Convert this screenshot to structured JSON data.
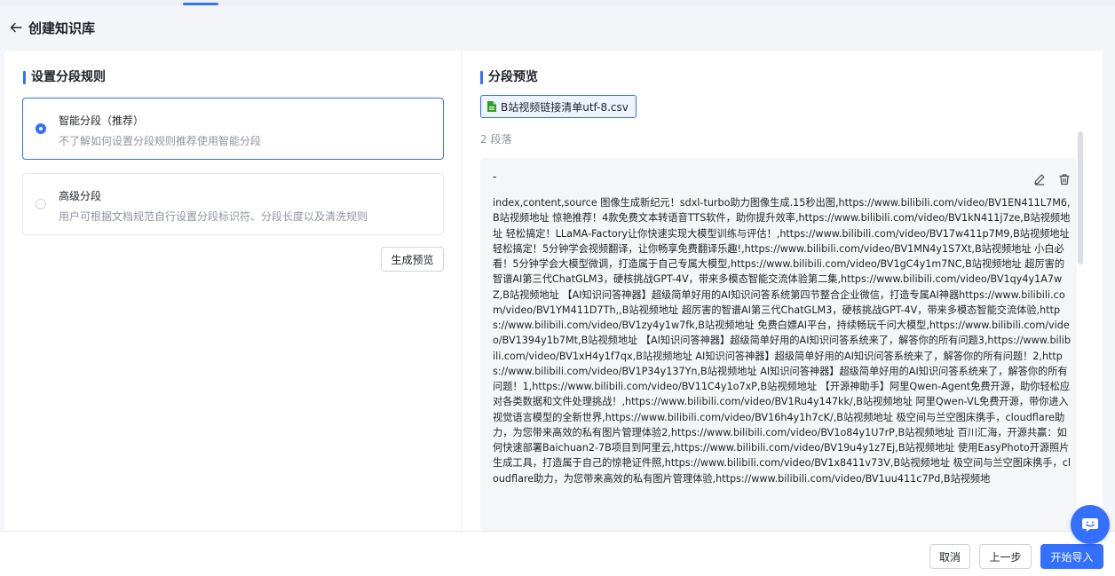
{
  "header": {
    "title": "创建知识库"
  },
  "left": {
    "title": "设置分段规则",
    "rules": [
      {
        "name": "智能分段（推荐）",
        "desc": "不了解如何设置分段规则推荐使用智能分段",
        "selected": true
      },
      {
        "name": "高级分段",
        "desc": "用户可根据文档规范自行设置分段标识符、分段长度以及清洗规则",
        "selected": false
      }
    ],
    "preview_button": "生成预览"
  },
  "right": {
    "title": "分段预览",
    "file_name": "B站视频链接清单utf-8.csv",
    "segment_count": "2 段落",
    "segment": {
      "title": "-",
      "content": "index,content,source 图像生成新纪元！sdxl-turbo助力图像生成.15秒出图,https://www.bilibili.com/video/BV1EN411L7M6,B站视频地址 惊艳推荐！4款免费文本转语音TTS软件，助你提升效率,https://www.bilibili.com/video/BV1kN411j7ze,B站视频地址 轻松搞定！LLaMA-Factory让你快速实现大模型训练与评估！,https://www.bilibili.com/video/BV17w411p7M9,B站视频地址 轻松搞定！5分钟学会视频翻译，让你畅享免费翻译乐趣!,https://www.bilibili.com/video/BV1MN4y1S7Xt,B站视频地址 小白必看！5分钟学会大模型微调，打造属于自己专属大模型,https://www.bilibili.com/video/BV1gC4y1m7NC,B站视频地址 超厉害的智谱AI第三代ChatGLM3，硬核挑战GPT-4V，带来多模态智能交流体验第二集,https://www.bilibili.com/video/BV1qy4y1A7wZ,B站视频地址 【AI知识问答神器】超级简单好用的AI知识问答系统第四节整合企业微信，打造专属AI神器https://www.bilibili.com/video/BV1YM411D7Th,,B站视频地址 超厉害的智谱AI第三代ChatGLM3，硬核挑战GPT-4V，带来多模态智能交流体验,https://www.bilibili.com/video/BV1zy4y1w7fk,B站视频地址 免费白嫖AI平台，持续畅玩千问大模型,https://www.bilibili.com/video/BV1394y1b7Mt,B站视频地址 【AI知识问答神器】超级简单好用的AI知识问答系统来了，解答你的所有问题3,https://www.bilibili.com/video/BV1xH4y1f7qx,B站视频地址 AI知识问答神器】超级简单好用的AI知识问答系统来了，解答你的所有问题！2,https://www.bilibili.com/video/BV1P34y137Yn,B站视频地址 AI知识问答神器】超级简单好用的AI知识问答系统来了，解答你的所有问题！1,https://www.bilibili.com/video/BV11C4y1o7xP,B站视频地址 【开源神助手】阿里Qwen-Agent免费开源，助你轻松应对各类数据和文件处理挑战！,https://www.bilibili.com/video/BV1Ru4y147kk/,B站视频地址 阿里Qwen-VL免费开源，带你进入视觉语言模型的全新世界,https://www.bilibili.com/video/BV16h4y1h7cK/,B站视频地址 极空间与兰空图床携手，cloudflare助力，为您带来高效的私有图片管理体验2,https://www.bilibili.com/video/BV1o84y1U7rP,B站视频地址 百川汇海，开源共赢：如何快速部署Baichuan2-7B项目到阿里云,https://www.bilibili.com/video/BV19u4y1z7Ej,B站视频地址 使用EasyPhoto开源照片生成工具，打造属于自己的惊艳证件照,https://www.bilibili.com/video/BV1x8411v73V,B站视频地址 极空间与兰空图床携手，cloudflare助力，为您带来高效的私有图片管理体验,https://www.bilibili.com/video/BV1uu411c7Pd,B站视频地"
    }
  },
  "footer": {
    "cancel": "取消",
    "prev": "上一步",
    "start": "开始导入"
  },
  "colors": {
    "accent": "#3370ff"
  }
}
